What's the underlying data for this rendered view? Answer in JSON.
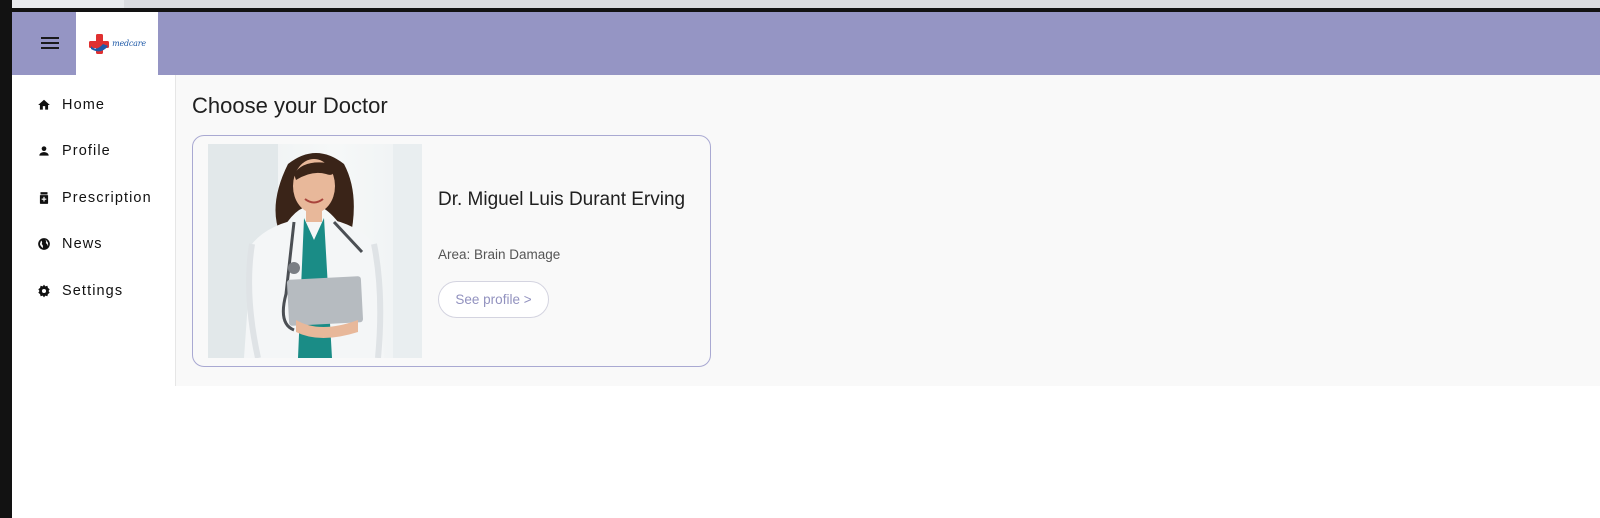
{
  "header": {
    "menu_icon": "hamburger-menu-icon",
    "logo_text": "medcare",
    "bar_color": "#9595c4"
  },
  "sidebar": {
    "items": [
      {
        "label": "Home",
        "icon": "home-icon"
      },
      {
        "label": "Profile",
        "icon": "person-icon"
      },
      {
        "label": "Prescription",
        "icon": "medication-icon"
      },
      {
        "label": "News",
        "icon": "globe-icon"
      },
      {
        "label": "Settings",
        "icon": "gear-icon"
      }
    ]
  },
  "main": {
    "title": "Choose your Doctor",
    "doctors": [
      {
        "name": "Dr. Miguel Luis Durant Erving",
        "area": "Area: Brain Damage",
        "button_label": "See profile >"
      }
    ]
  },
  "colors": {
    "accent": "#9595c4",
    "card_border": "#a9a9d2",
    "button_text": "#9292bf"
  }
}
